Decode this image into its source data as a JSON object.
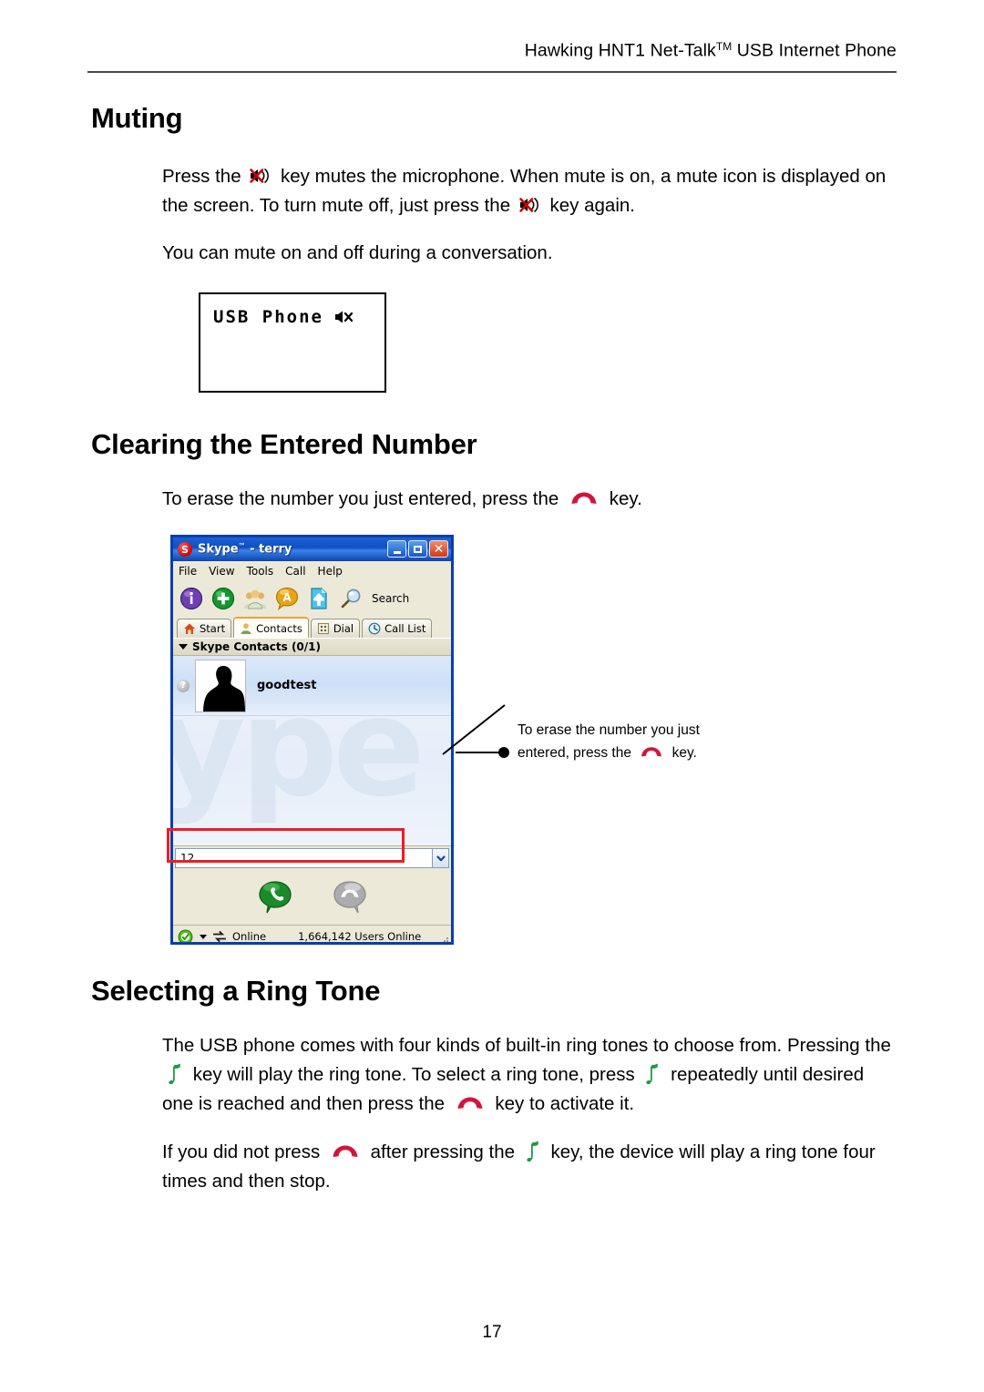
{
  "document": {
    "header": "Hawking HNT1 Net-Talk",
    "header_tm": "TM",
    "header_tail": " USB Internet Phone",
    "page_number": "17"
  },
  "sections": {
    "muting": {
      "heading": "Muting",
      "p1_a": "Press the",
      "p1_b": "key mutes the microphone. When mute is on, a mute icon is displayed on the screen. To turn mute off, just press the",
      "p1_c": "key again.",
      "p2": "You can mute on and off during a conversation.",
      "lcd_text": "USB Phone",
      "lcd_icon": "speaker-mute-icon"
    },
    "clearing": {
      "heading": "Clearing the Entered Number",
      "p1_a": "To erase the number you just entered, press the",
      "p1_b": "key."
    },
    "ringtone": {
      "heading": "Selecting a Ring Tone",
      "p1_a": "The USB phone comes with four kinds of built-in ring tones to choose from. Pressing the",
      "p1_b": "key will play the ring tone. To select a ring tone, press",
      "p1_c": "repeatedly until desired one is reached and then press the",
      "p1_d": "key to activate it.",
      "p2_a": "If you did not press",
      "p2_b": "after pressing the",
      "p2_c": "key, the device will play a ring tone four times and then stop."
    }
  },
  "callout": {
    "line1": "To erase the number you just",
    "line2_a": "entered, press the",
    "line2_b": "key."
  },
  "skype": {
    "title": "Skype",
    "title_tm": "™",
    "title_user": " - terry",
    "logo_letter": "S",
    "window_buttons": [
      "minimize",
      "maximize",
      "close"
    ],
    "close_glyph": "✕",
    "menu": [
      "File",
      "View",
      "Tools",
      "Call",
      "Help"
    ],
    "toolbar": {
      "icons": [
        "info-icon",
        "add-contact-icon",
        "group-icon",
        "alert-bubble-icon",
        "file-transfer-icon",
        "search-icon"
      ],
      "search_label": "Search"
    },
    "tabs": [
      {
        "label": "Start",
        "icon": "home-icon",
        "active": false
      },
      {
        "label": "Contacts",
        "icon": "contacts-icon",
        "active": true
      },
      {
        "label": "Dial",
        "icon": "dialpad-icon",
        "active": false
      },
      {
        "label": "Call List",
        "icon": "clock-icon",
        "active": false
      }
    ],
    "group_header": "Skype Contacts (0/1)",
    "watermark": "ype",
    "contacts": [
      {
        "name": "goodtest",
        "status_glyph": "?",
        "avatar": "silhouette-avatar"
      }
    ],
    "dial_input": {
      "value": "12",
      "placeholder": ""
    },
    "buttons": {
      "call": "green-call-button",
      "hangup": "gray-hangup-button"
    },
    "status_bar": {
      "presence": "Online",
      "users_online": "1,664,142 Users Online"
    }
  },
  "icons": {
    "mute_key": "mute-key-icon",
    "hangup_key": "hangup-key-icon",
    "ringtone_key": "music-note-key-icon"
  },
  "colors": {
    "highlight_red": "#ee1c25",
    "hangup_red": "#d3143c",
    "note_green": "#1f9a46",
    "skype_blue": "#0b3fa8",
    "window_chrome": "#ece9d8"
  }
}
